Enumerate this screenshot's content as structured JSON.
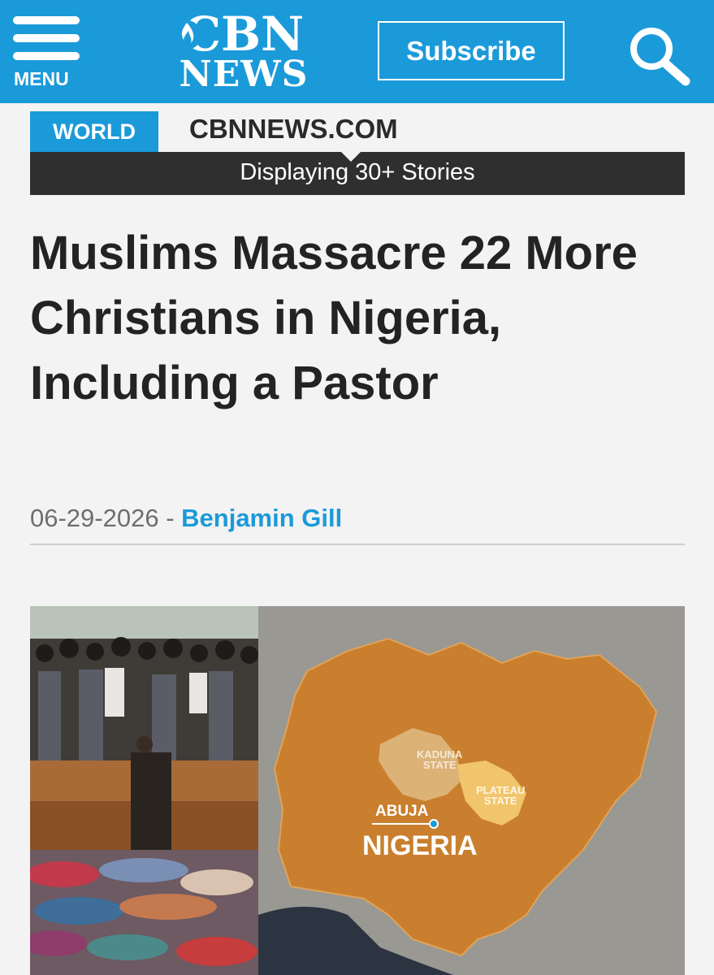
{
  "header": {
    "menu_label": "MENU",
    "logo_top": "CBN",
    "logo_bottom": "NEWS",
    "subscribe_label": "Subscribe",
    "colors": {
      "brand": "#1b9ad9",
      "dark_bar": "#2f2f2f",
      "text": "#232323"
    },
    "icons": [
      "hamburger-menu-icon",
      "flame-icon",
      "search-icon"
    ]
  },
  "section": {
    "tag": "WORLD",
    "site": "CBNNEWS.COM",
    "stories_label": "Displaying 30+ Stories"
  },
  "article": {
    "headline": "Muslims Massacre 22 More Christians in Nigeria, Including a Pastor",
    "date": "06-29-2026",
    "separator": " - ",
    "author": "Benjamin Gill"
  },
  "map": {
    "kaduna_line1": "KADUNA",
    "kaduna_line2": "STATE",
    "plateau_line1": "PLATEAU",
    "plateau_line2": "STATE",
    "abuja": "ABUJA",
    "country": "NIGERIA"
  }
}
